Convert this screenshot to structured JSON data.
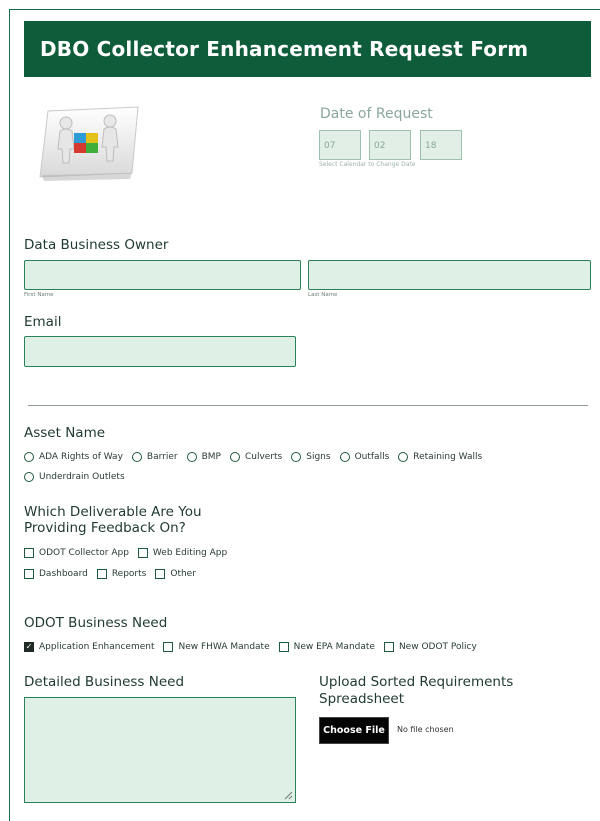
{
  "form": {
    "title": "DBO Collector Enhancement Request Form",
    "logo_icon": "people-puzzle-teamwork-icon"
  },
  "date": {
    "label": "Date of Request",
    "month": "07",
    "day": "02",
    "year": "18",
    "hint": "Select Calendar to Change Date"
  },
  "owner": {
    "label": "Data Business Owner",
    "first_name_value": "",
    "first_name_caption": "First Name",
    "last_name_value": "",
    "last_name_caption": "Last Name"
  },
  "email": {
    "label": "Email",
    "value": ""
  },
  "asset": {
    "label": "Asset Name",
    "options": [
      "ADA Rights of Way",
      "Barrier",
      "BMP",
      "Culverts",
      "Signs",
      "Outfalls",
      "Retaining Walls",
      "Underdrain Outlets"
    ]
  },
  "deliverable": {
    "label_line1": "Which Deliverable Are You",
    "label_line2": "Providing Feedback On?",
    "options": [
      "ODOT Collector App",
      "Web Editing App",
      "Dashboard",
      "Reports",
      "Other"
    ]
  },
  "business_need": {
    "label": "ODOT Business Need",
    "options": [
      {
        "label": "Application Enhancement",
        "checked": true
      },
      {
        "label": "New FHWA Mandate",
        "checked": false
      },
      {
        "label": "New EPA Mandate",
        "checked": false
      },
      {
        "label": "New ODOT Policy",
        "checked": false
      }
    ]
  },
  "detailed": {
    "label": "Detailed Business Need",
    "value": ""
  },
  "upload": {
    "label_line1": "Upload Sorted Requirements",
    "label_line2": "Spreadsheet",
    "button_label": "Choose File",
    "status": "No file chosen"
  },
  "colors": {
    "header_bg": "#0f5c3b",
    "field_bg": "#dff0e6",
    "field_border": "#2b8158"
  }
}
